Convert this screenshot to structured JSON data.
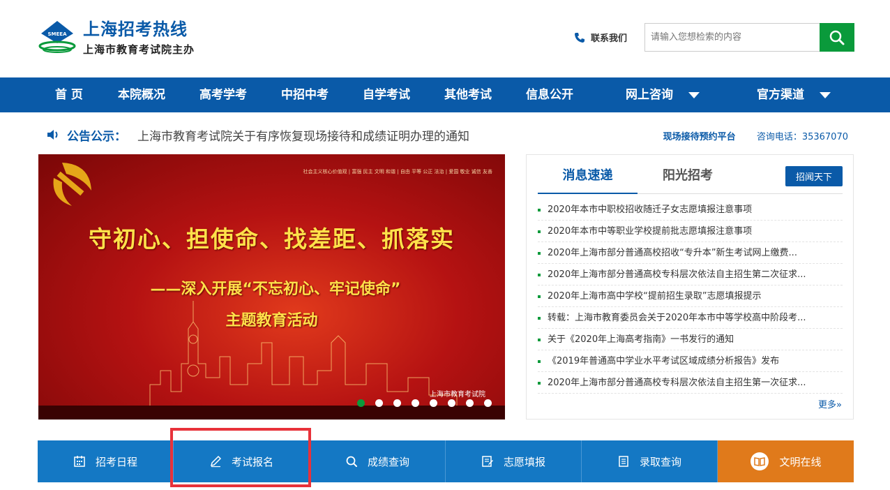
{
  "site": {
    "logo_badge": "SMEEA",
    "title": "上海招考热线",
    "subtitle": "上海市教育考试院主办"
  },
  "header": {
    "contact_label": "联系我们",
    "search_placeholder": "请输入您想检索的内容"
  },
  "nav": {
    "items": [
      "首 页",
      "本院概况",
      "高考学考",
      "中招中考",
      "自学考试",
      "其他考试",
      "信息公开",
      "网上咨询",
      "官方渠道"
    ]
  },
  "notice": {
    "label": "公告公示：",
    "text": "上海市教育考试院关于有序恢复现场接待和成绩证明办理的通知",
    "platform_link": "现场接待预约平台",
    "phone": "咨询电话：35367070"
  },
  "banner": {
    "headline": "守初心、担使命、找差距、抓落实",
    "line2": "——深入开展“不忘初心、牢记使命”",
    "line3": "主题教育活动",
    "top_text": "社会主义核心价值观 | 富强 民主 文明 和谐 | 自由 平等 公正 法治 | 爱国 敬业 诚信 友善",
    "org": "上海市教育考试院",
    "slide_count": 8,
    "active_slide": 1
  },
  "news": {
    "tab_active": "消息速递",
    "tab_other": "阳光招考",
    "button": "招闻天下",
    "items": [
      "2020年本市中职校招收随迁子女志愿填报注意事项",
      "2020年本市中等职业学校提前批志愿填报注意事项",
      "2020年上海市部分普通高校招收“专升本”新生考试网上缴费...",
      "2020年上海市部分普通高校专科层次依法自主招生第二次征求...",
      "2020年上海市高中学校“提前招生录取”志愿填报提示",
      "转载：上海市教育委员会关于2020年本市中等学校高中阶段考...",
      "关于《2020年上海高考指南》一书发行的通知",
      "《2019年普通高中学业水平考试区域成绩分析报告》发布",
      "2020年上海市部分普通高校专科层次依法自主招生第一次征求..."
    ],
    "more": "更多»"
  },
  "quickbar": {
    "items": [
      "招考日程",
      "考试报名",
      "成绩查询",
      "志愿填报",
      "录取查询",
      "文明在线"
    ]
  },
  "colors": {
    "brand_blue": "#0a5aa8",
    "bar_blue": "#1478c4",
    "green": "#0a9a3b",
    "orange": "#e07a1b",
    "highlight_red": "#e8323a"
  }
}
